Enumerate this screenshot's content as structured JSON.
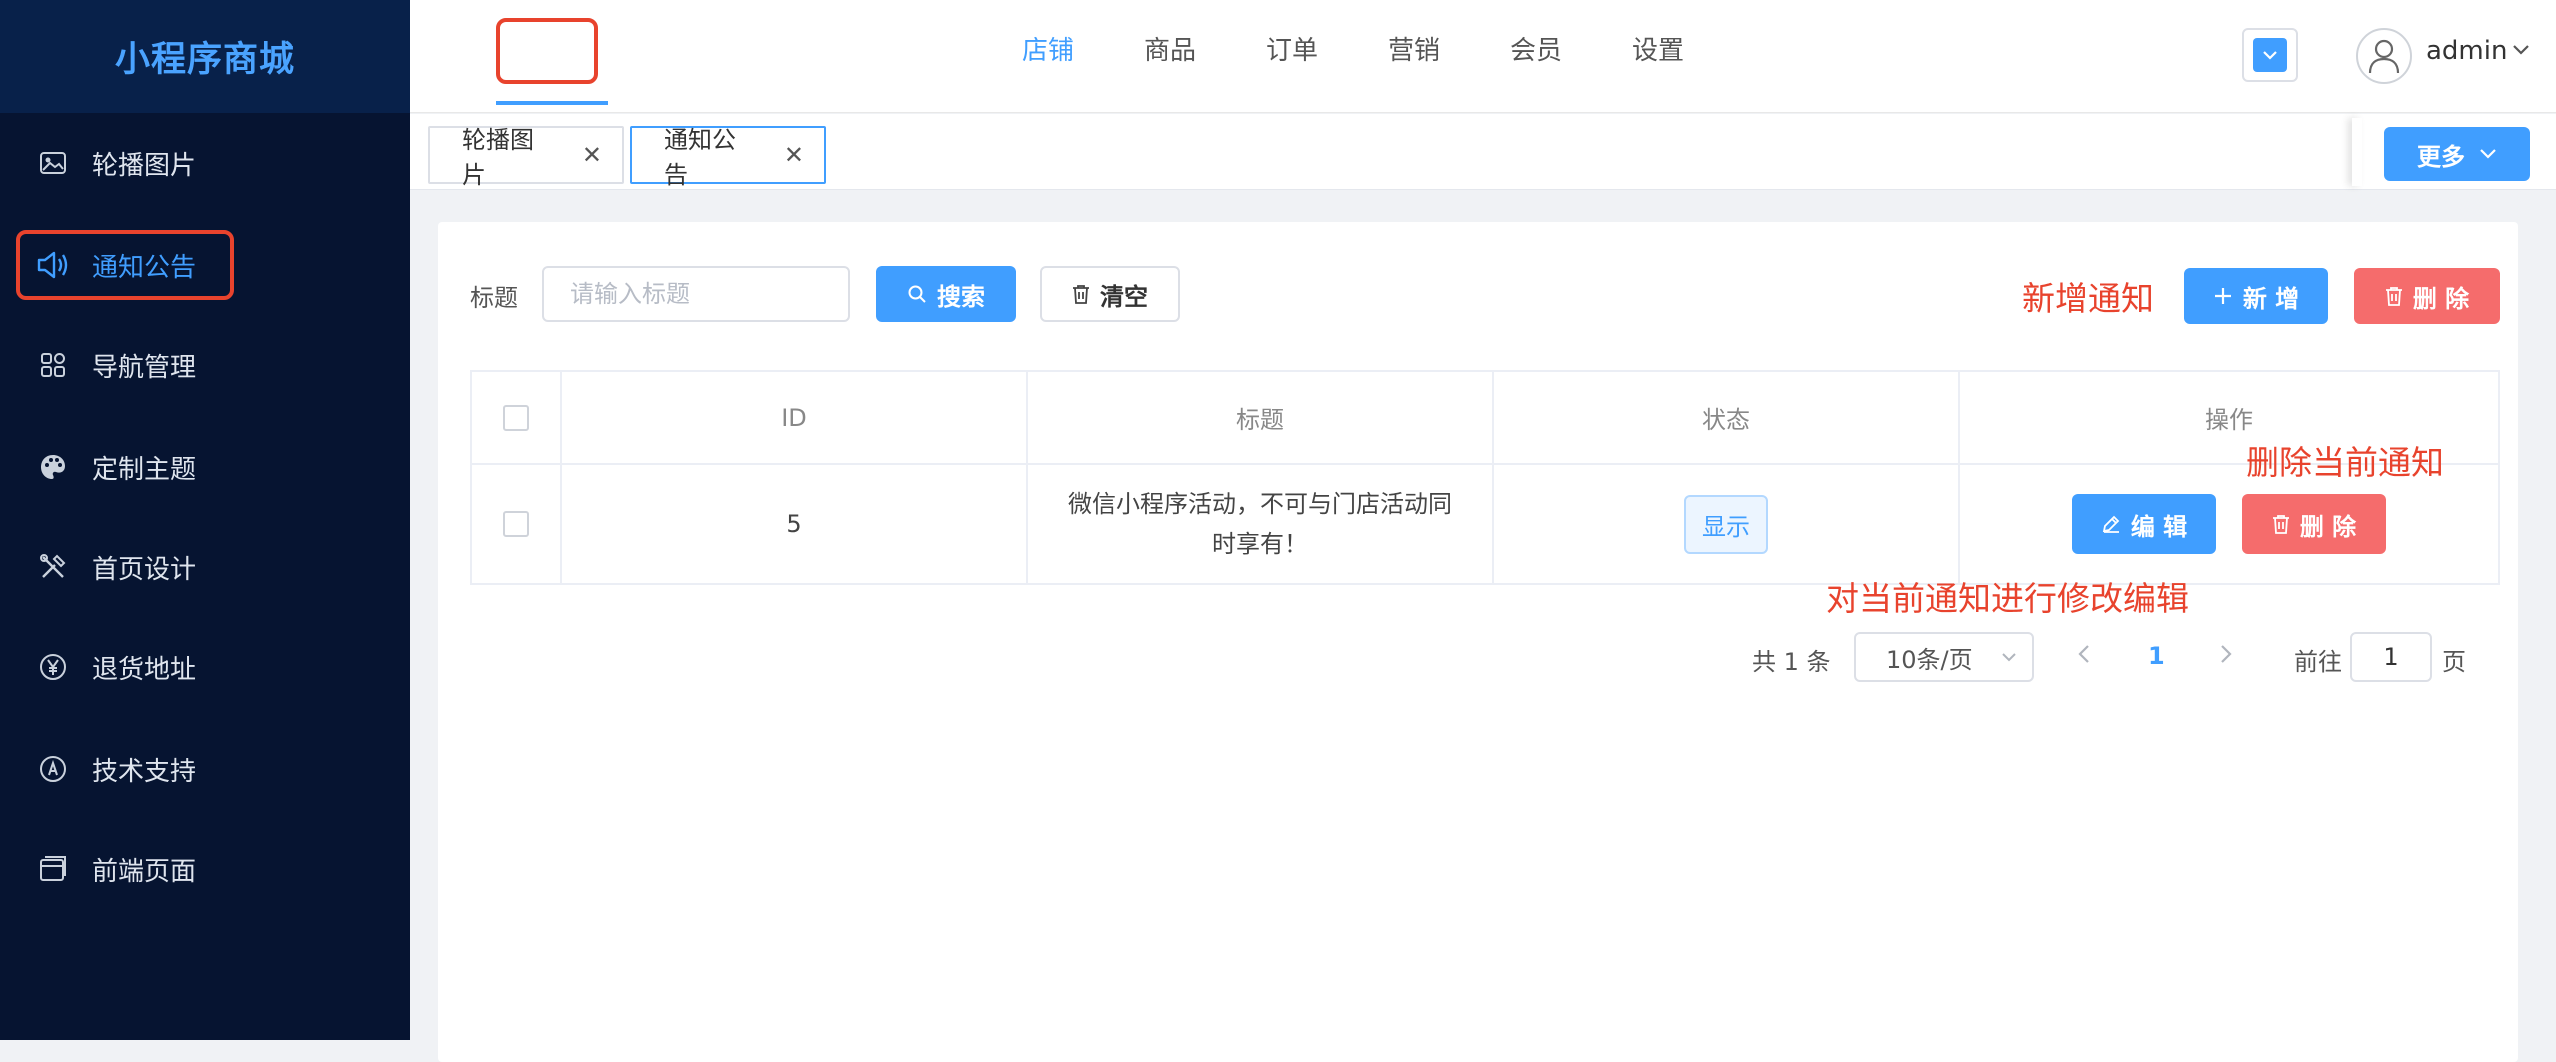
{
  "app": {
    "title": "小程序商城"
  },
  "sidebar": {
    "items": [
      {
        "label": "轮播图片",
        "icon": "image-icon"
      },
      {
        "label": "通知公告",
        "icon": "speaker-icon",
        "active": true
      },
      {
        "label": "导航管理",
        "icon": "grid-icon"
      },
      {
        "label": "定制主题",
        "icon": "palette-icon"
      },
      {
        "label": "首页设计",
        "icon": "tools-icon"
      },
      {
        "label": "退货地址",
        "icon": "yen-icon"
      },
      {
        "label": "技术支持",
        "icon": "support-icon"
      },
      {
        "label": "前端页面",
        "icon": "window-icon"
      }
    ]
  },
  "topnav": {
    "items": [
      {
        "label": "店铺",
        "active": true
      },
      {
        "label": "商品"
      },
      {
        "label": "订单"
      },
      {
        "label": "营销"
      },
      {
        "label": "会员"
      },
      {
        "label": "设置"
      }
    ]
  },
  "user": {
    "name": "admin"
  },
  "tabs": [
    {
      "label": "轮播图片"
    },
    {
      "label": "通知公告",
      "active": true
    }
  ],
  "more": {
    "label": "更多"
  },
  "filter": {
    "title_label": "标题",
    "title_placeholder": "请输入标题",
    "search_label": "搜索",
    "clear_label": "清空"
  },
  "actions": {
    "add_label": "新 增",
    "delete_label": "删 除"
  },
  "annotations": {
    "add": "新增通知",
    "delete": "删除当前通知",
    "edit": "对当前通知进行修改编辑"
  },
  "table": {
    "headers": {
      "id": "ID",
      "title": "标题",
      "status": "状态",
      "ops": "操作"
    },
    "rows": [
      {
        "id": "5",
        "title_line1": "微信小程序活动，不可与门店活动同",
        "title_line2": "时享有！",
        "status": "显示",
        "edit_label": "编 辑",
        "delete_label": "删 除"
      }
    ]
  },
  "pagination": {
    "total": "共 1 条",
    "page_size": "10条/页",
    "current": "1",
    "goto_label": "前往",
    "goto_value": "1",
    "page_suffix": "页"
  },
  "colors": {
    "primary": "#409eff",
    "danger": "#f56c6c",
    "sidebar": "#061431",
    "annotation": "#e8432d"
  }
}
